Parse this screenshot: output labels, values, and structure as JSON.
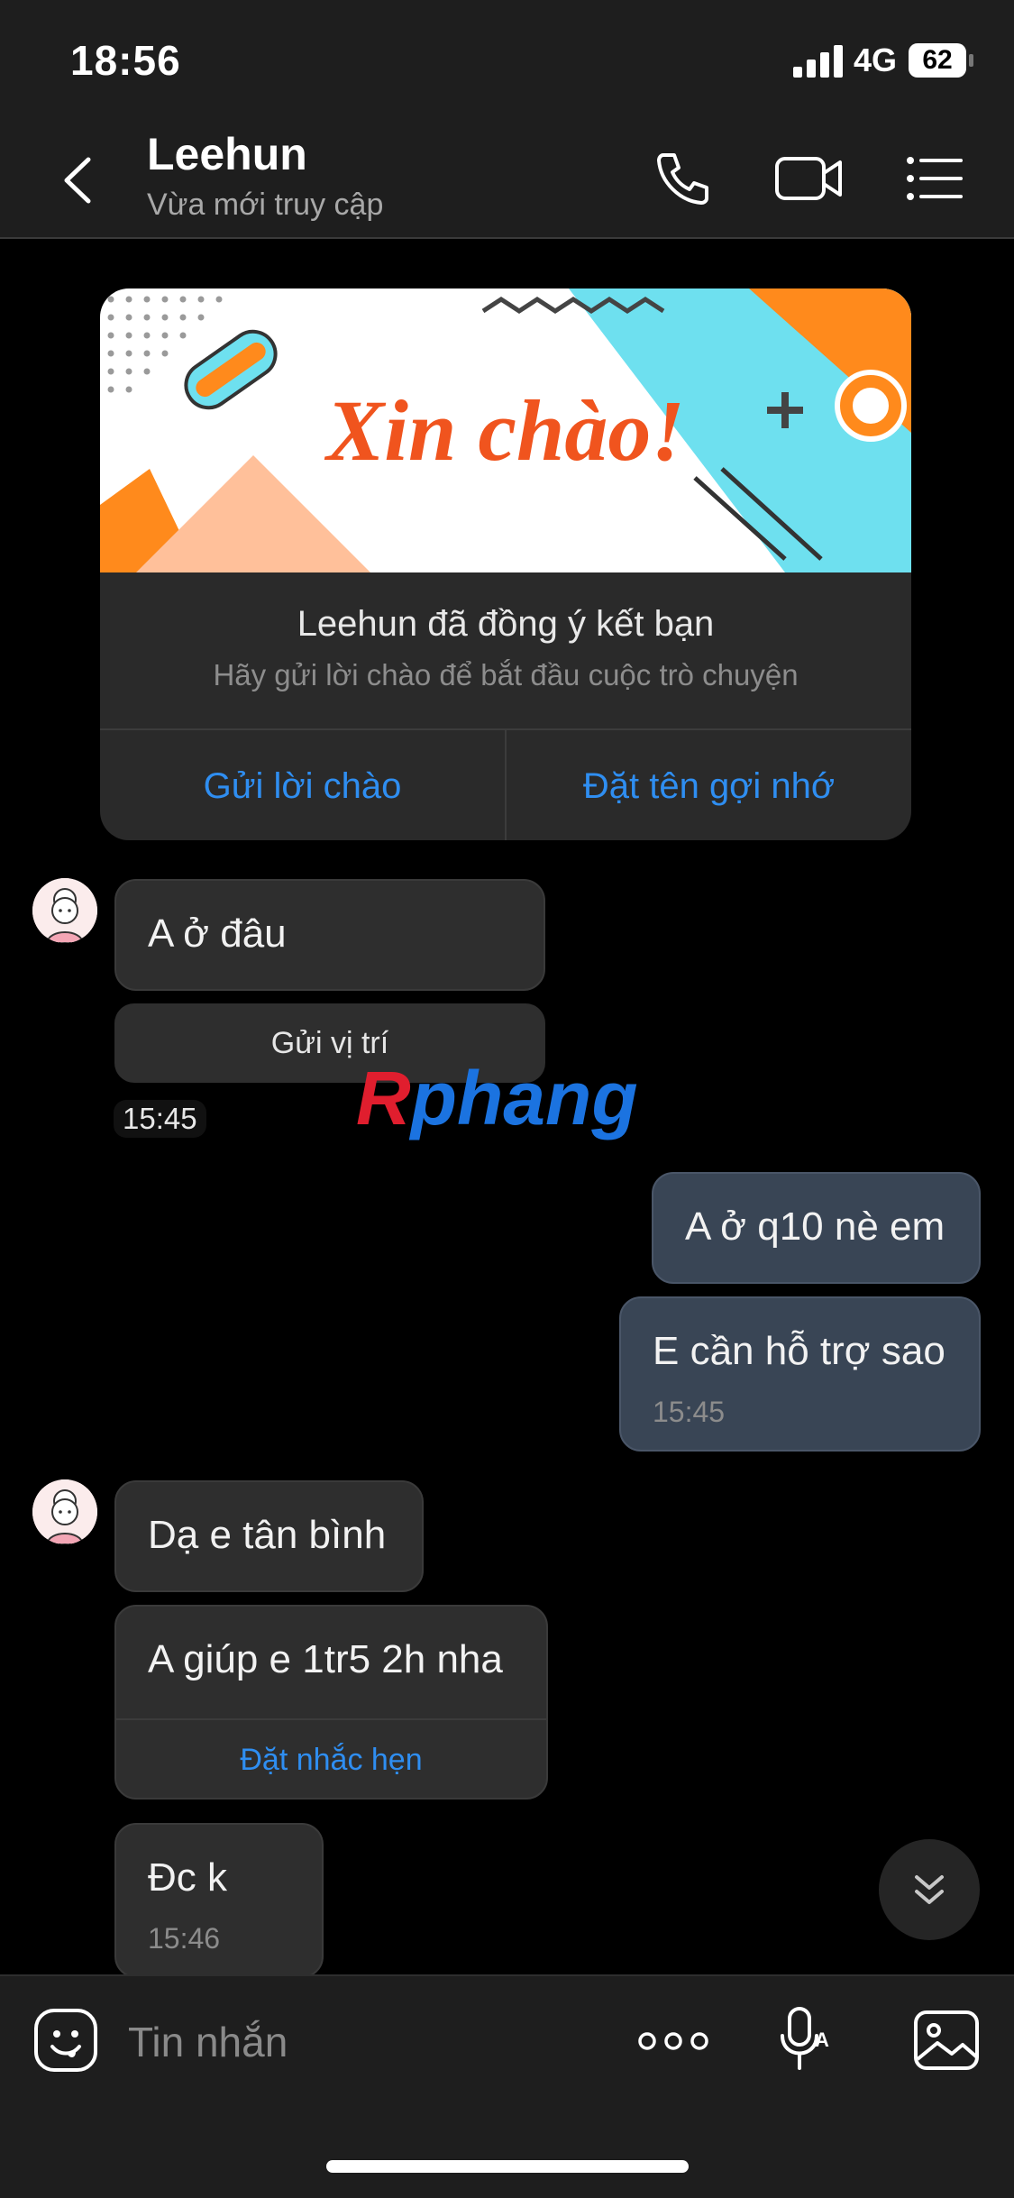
{
  "status_bar": {
    "time": "18:56",
    "network": "4G",
    "battery": "62"
  },
  "header": {
    "name": "Leehun",
    "status": "Vừa mới truy cập"
  },
  "greeting_card": {
    "banner_text": "Xin chào!",
    "title": "Leehun đã đồng ý kết bạn",
    "subtitle": "Hãy gửi lời chào để bắt đầu cuộc trò chuyện",
    "action_greet": "Gửi lời chào",
    "action_nickname": "Đặt tên gợi nhớ"
  },
  "messages": [
    {
      "from": "them",
      "text": "A ở đâu"
    },
    {
      "from": "them",
      "action": "Gửi vị trí",
      "time": "15:45"
    },
    {
      "from": "me",
      "text": "A ở q10 nè em"
    },
    {
      "from": "me",
      "text": "E cần hỗ trợ sao",
      "time": "15:45"
    },
    {
      "from": "them",
      "text": "Dạ e tân bình"
    },
    {
      "from": "them",
      "text": "A giúp e 1tr5 2h nha",
      "action": "Đặt nhắc hẹn"
    },
    {
      "from": "them",
      "text": "Đc k",
      "time": "15:46"
    }
  ],
  "watermark": {
    "part1": "R",
    "part2": "phang"
  },
  "input": {
    "placeholder": "Tin nhắn"
  },
  "colors": {
    "accent": "#2f8ef1",
    "my_bubble": "#394555",
    "their_bubble": "#2e2e2e"
  }
}
